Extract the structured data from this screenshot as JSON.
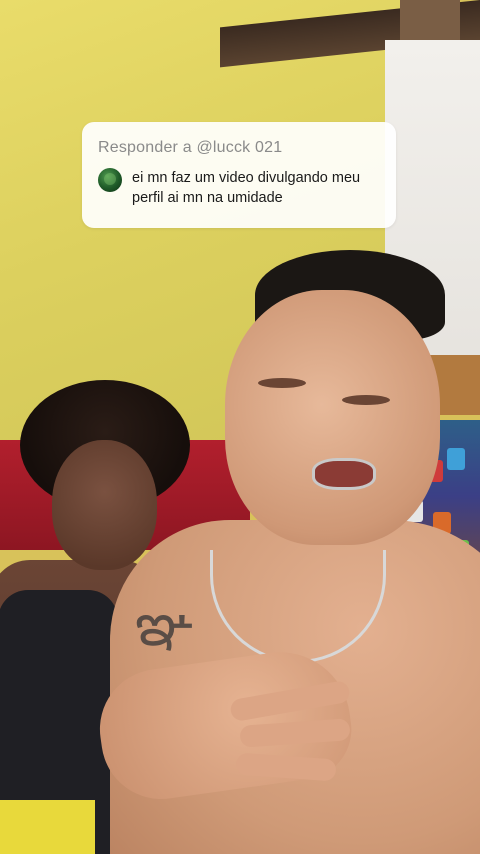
{
  "reply_sticker": {
    "header": "Responder a @lucck 021",
    "comment": "ei mn faz um video divulgando meu perfil ai mn na umidade",
    "avatar_icon": "user-avatar-icon"
  },
  "colors": {
    "sticker_background": "#FFFFFF",
    "header_text": "#8A8A8A",
    "comment_text": "#1A1A1A",
    "wall_yellow": "#E0D463",
    "sofa_red": "#A81C2A"
  }
}
